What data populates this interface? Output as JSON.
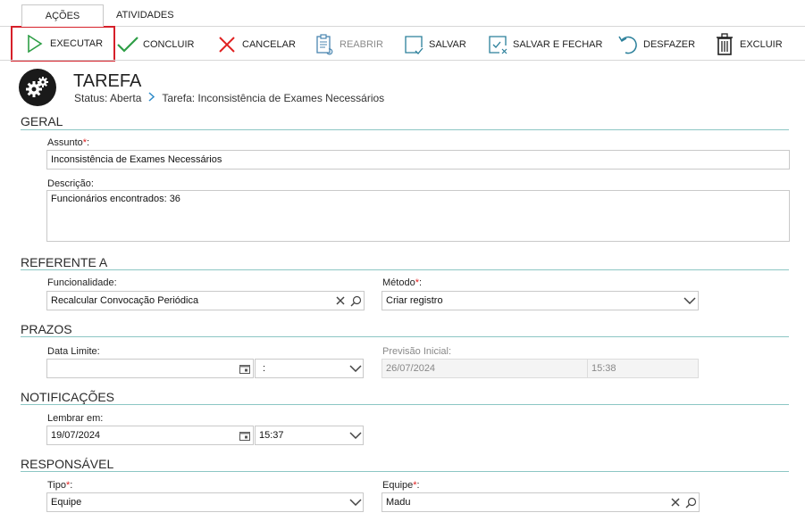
{
  "tabs": [
    "AÇÕES",
    "ATIVIDADES"
  ],
  "toolbar": {
    "executar": "EXECUTAR",
    "concluir": "CONCLUIR",
    "cancelar": "CANCELAR",
    "reabrir": "REABRIR",
    "salvar": "SALVAR",
    "salvar_fechar": "SALVAR E FECHAR",
    "desfazer": "DESFAZER",
    "excluir": "EXCLUIR"
  },
  "header": {
    "title": "TAREFA",
    "status": "Status: Aberta",
    "task": "Tarefa: Inconsistência de Exames Necessários"
  },
  "geral": {
    "title": "GERAL",
    "assunto_label": "Assunto",
    "assunto_value": "Inconsistência de Exames Necessários",
    "descricao_label": "Descrição:",
    "descricao_value": "Funcionários encontrados: 36"
  },
  "referente": {
    "title": "REFERENTE A",
    "funcionalidade_label": "Funcionalidade:",
    "funcionalidade_value": "Recalcular Convocação Periódica",
    "metodo_label": "Método",
    "metodo_value": "Criar registro"
  },
  "prazos": {
    "title": "PRAZOS",
    "data_limite_label": "Data Limite:",
    "data_limite_value": "",
    "data_limite_time": ":",
    "previsao_label": "Previsão Inicial:",
    "previsao_date": "26/07/2024",
    "previsao_time": "15:38"
  },
  "notificacoes": {
    "title": "NOTIFICAÇÕES",
    "lembrar_label": "Lembrar em:",
    "lembrar_date": "19/07/2024",
    "lembrar_time": "15:37"
  },
  "responsavel": {
    "title": "RESPONSÁVEL",
    "tipo_label": "Tipo",
    "tipo_value": "Equipe",
    "equipe_label": "Equipe",
    "equipe_value": "Madu"
  },
  "colors": {
    "accent_line": "#8cc6c4",
    "required": "#e02020",
    "highlight": "#d6202a",
    "executar_icon": "#2e9e46",
    "concluir_icon": "#2e9e46",
    "cancelar_icon": "#e02020",
    "teal_icon": "#2a7f9a"
  }
}
